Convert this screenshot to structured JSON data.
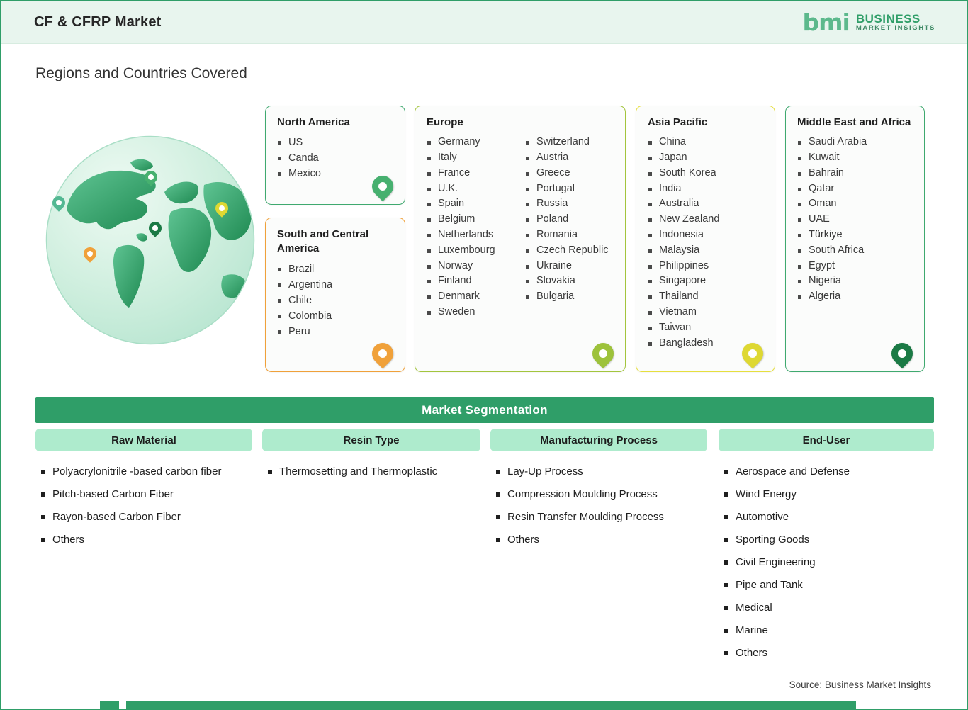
{
  "header": {
    "title": "CF & CFRP Market",
    "logo_mark": "bmi",
    "logo_line1": "BUSINESS",
    "logo_line2": "MARKET INSIGHTS"
  },
  "page_title": "Regions and Countries Covered",
  "regions": {
    "north_america": {
      "name": "North America",
      "accent": "#3fa96f",
      "countries": [
        "US",
        "Canda",
        "Mexico"
      ]
    },
    "south_central_america": {
      "name": "South and Central America",
      "accent": "#f0a13a",
      "countries": [
        "Brazil",
        "Argentina",
        "Chile",
        "Colombia",
        "Peru"
      ]
    },
    "europe": {
      "name": "Europe",
      "accent": "#a3c53d",
      "countries_left": [
        "Germany",
        "Italy",
        "France",
        "U.K.",
        "Spain",
        "Belgium",
        "Netherlands",
        "Luxembourg",
        "Norway",
        "Finland",
        "Denmark",
        "Sweden"
      ],
      "countries_right": [
        "Switzerland",
        "Austria",
        "Greece",
        "Portugal",
        "Russia",
        "Poland",
        "Romania",
        "Czech Republic",
        "Ukraine",
        "Slovakia",
        "Bulgaria"
      ]
    },
    "asia_pacific": {
      "name": "Asia Pacific",
      "accent": "#e6df3e",
      "countries": [
        "China",
        "Japan",
        "South Korea",
        "India",
        "Australia",
        "New Zealand",
        "Indonesia",
        "Malaysia",
        "Philippines",
        "Singapore",
        "Thailand",
        "Vietnam",
        "Taiwan",
        "Bangladesh"
      ]
    },
    "middle_east_africa": {
      "name": "Middle East and Africa",
      "accent": "#3fa96f",
      "countries": [
        "Saudi Arabia",
        "Kuwait",
        "Bahrain",
        "Qatar",
        "Oman",
        "UAE",
        "Türkiye",
        "South Africa",
        "Egypt",
        "Nigeria",
        "Algeria"
      ]
    }
  },
  "segmentation": {
    "title": "Market Segmentation",
    "columns": [
      {
        "header": "Raw Material",
        "items": [
          "Polyacrylonitrile -based carbon fiber",
          "Pitch-based Carbon Fiber",
          "Rayon-based Carbon Fiber",
          "Others"
        ]
      },
      {
        "header": "Resin Type",
        "items": [
          "Thermosetting and Thermoplastic"
        ]
      },
      {
        "header": "Manufacturing Process",
        "items": [
          "Lay-Up Process",
          "Compression Moulding Process",
          "Resin Transfer Moulding Process",
          "Others"
        ]
      },
      {
        "header": "End-User",
        "items": [
          "Aerospace and Defense",
          "Wind Energy",
          "Automotive",
          "Sporting Goods",
          "Civil Engineering",
          "Pipe and Tank",
          "Medical",
          "Marine",
          "Others"
        ]
      }
    ]
  },
  "source_note": "Source: Business Market Insights",
  "colors": {
    "brand_green": "#2f9e68",
    "header_bg": "#e8f5ee",
    "segment_header_bg": "#aeebcd",
    "orange_accent": "#f0a13a",
    "yellow_green_accent": "#a3c53d",
    "yellow_accent": "#e6df3e",
    "dark_green_pin": "#1b7a45"
  }
}
